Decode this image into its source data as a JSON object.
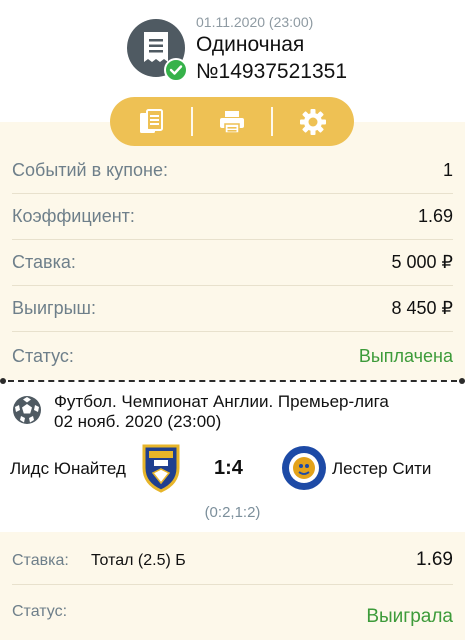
{
  "header": {
    "date": "01.11.2020 (23:00)",
    "type": "Одиночная",
    "number": "№14937521351",
    "icon": "receipt-icon",
    "status_icon": "check-circle-icon"
  },
  "toolbar": {
    "buttons": [
      {
        "icon": "copy-icon"
      },
      {
        "icon": "print-icon"
      },
      {
        "icon": "gear-icon"
      }
    ]
  },
  "summary": {
    "rows": [
      {
        "label": "Событий в купоне:",
        "value": "1"
      },
      {
        "label": "Коэффициент:",
        "value": "1.69"
      },
      {
        "label": "Ставка:",
        "value": "5 000 ₽"
      },
      {
        "label": "Выигрыш:",
        "value": "8 450 ₽"
      },
      {
        "label": "Статус:",
        "value": "Выплачена"
      }
    ]
  },
  "event": {
    "sport_icon": "soccer-ball-icon",
    "tournament": "Футбол. Чемпионат Англии. Премьер-лига",
    "date": "02 нояб. 2020 (23:00)",
    "home_team": "Лидс Юнайтед",
    "away_team": "Лестер Сити",
    "score": "1:4",
    "half_scores": "(0:2,1:2)"
  },
  "bet": {
    "stake_label": "Ставка:",
    "market": "Тотал (2.5) Б",
    "odds": "1.69",
    "status_label": "Статус:",
    "status": "Выиграла"
  },
  "colors": {
    "accent": "#eec154",
    "panel_bg": "#fdf8ea",
    "success": "#3d9b3a",
    "label": "#6e7f8a"
  }
}
